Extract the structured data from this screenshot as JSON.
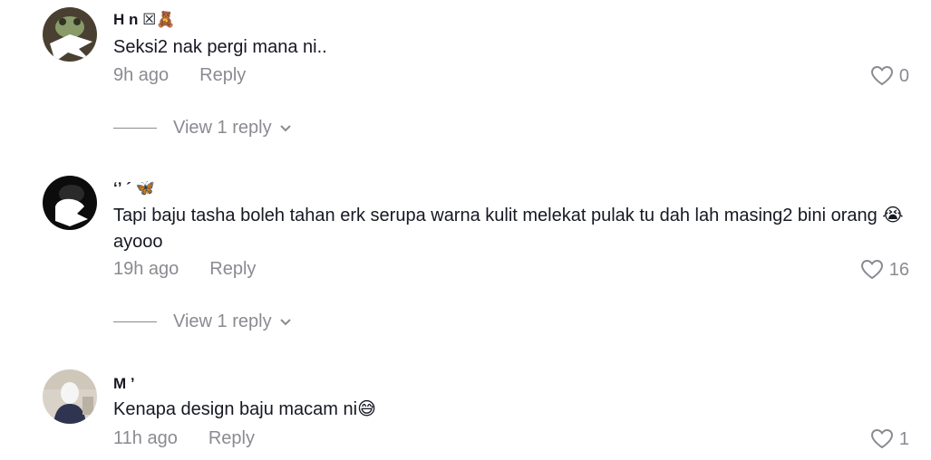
{
  "comments": [
    {
      "username": "H          n ☒🧸",
      "text": "Seksi2 nak pergi mana ni..",
      "time": "9h ago",
      "reply_label": "Reply",
      "likes": "0",
      "view_replies": "View 1 reply",
      "avatar_icon": "frog-avatar"
    },
    {
      "username": "ʻʼ  ´ 🦋",
      "text": "Tapi baju tasha boleh tahan erk serupa warna kulit melekat pulak tu dah lah masing2 bini orang 😭 ayooo",
      "time": "19h ago",
      "reply_label": "Reply",
      "likes": "16",
      "view_replies": "View 1 reply",
      "avatar_icon": "dark-avatar"
    },
    {
      "username": "M     ʼ",
      "text": "Kenapa design baju macam ni😅",
      "time": "11h ago",
      "reply_label": "Reply",
      "likes": "1",
      "avatar_icon": "photo-avatar"
    }
  ],
  "colors": {
    "text": "#161823",
    "muted": "#8a8b91"
  }
}
